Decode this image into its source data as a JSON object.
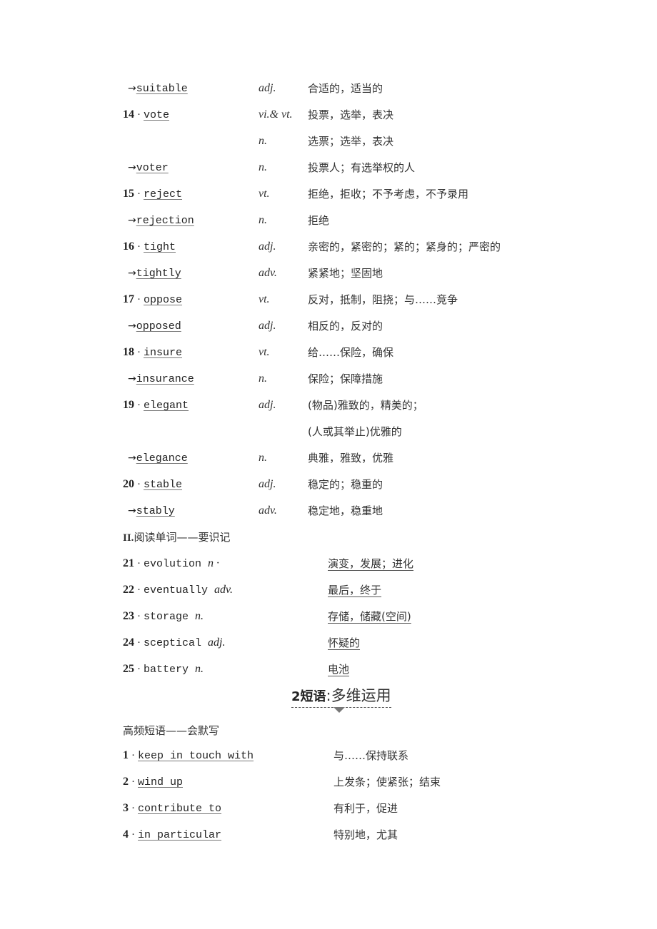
{
  "vocab": [
    {
      "num": "",
      "derived": true,
      "word": "suitable",
      "pos": "adj.",
      "meaning": "合适的，适当的"
    },
    {
      "num": "14",
      "derived": false,
      "word": "vote",
      "pos": "vi.& vt.",
      "meaning": "投票，选举，表决"
    },
    {
      "num": "",
      "derived": false,
      "word": "",
      "pos": "n.",
      "meaning": "选票；选举，表决"
    },
    {
      "num": "",
      "derived": true,
      "word": "voter",
      "pos": "n.",
      "meaning": "投票人；有选举权的人"
    },
    {
      "num": "15",
      "derived": false,
      "word": "reject",
      "pos": "vt.",
      "meaning": "拒绝，拒收；不予考虑，不予录用"
    },
    {
      "num": "",
      "derived": true,
      "word": "rejection",
      "pos": "n.",
      "meaning": "拒绝"
    },
    {
      "num": "16",
      "derived": false,
      "word": "tight",
      "pos": "adj.",
      "meaning": "亲密的，紧密的；紧的；紧身的；严密的"
    },
    {
      "num": "",
      "derived": true,
      "word": "tightly",
      "pos": "adv.",
      "meaning": "紧紧地；坚固地"
    },
    {
      "num": "17",
      "derived": false,
      "word": "oppose",
      "pos": "vt.",
      "meaning": "反对，抵制，阻挠；与……竞争"
    },
    {
      "num": "",
      "derived": true,
      "word": "opposed",
      "pos": "adj.",
      "meaning": "相反的，反对的"
    },
    {
      "num": "18",
      "derived": false,
      "word": "insure",
      "pos": "vt.",
      "meaning": "给……保险，确保"
    },
    {
      "num": "",
      "derived": true,
      "word": "insurance",
      "pos": "n.",
      "meaning": "保险；保障措施"
    },
    {
      "num": "19",
      "derived": false,
      "word": "elegant",
      "pos": "adj.",
      "meaning": "(物品)雅致的，精美的；"
    },
    {
      "num": "",
      "derived": false,
      "word": "",
      "pos": "",
      "meaning": "(人或其举止)优雅的"
    },
    {
      "num": "",
      "derived": true,
      "word": "elegance",
      "pos": "n.",
      "meaning": "典雅，雅致，优雅"
    },
    {
      "num": "20",
      "derived": false,
      "word": "stable",
      "pos": "adj.",
      "meaning": "稳定的；稳重的"
    },
    {
      "num": "",
      "derived": true,
      "word": "stably",
      "pos": "adv.",
      "meaning": "稳定地，稳重地"
    }
  ],
  "reading_section": {
    "title_num": "II.",
    "title": "阅读单词——要识记",
    "items": [
      {
        "num": "21",
        "word": "evolution",
        "pos": "n ·",
        "meaning": "演变，发展；进化"
      },
      {
        "num": "22",
        "word": "eventually",
        "pos": "adv.",
        "meaning": "最后，终于"
      },
      {
        "num": "23",
        "word": "storage",
        "pos": "n.",
        "meaning": "存储，储藏(空间)"
      },
      {
        "num": "24",
        "word": "sceptical",
        "pos": "adj.",
        "meaning": "怀疑的"
      },
      {
        "num": "25",
        "word": "battery",
        "pos": "n.",
        "meaning": "电池"
      }
    ]
  },
  "phrase_heading": {
    "num": "2",
    "bold": "短语",
    "sep": ":",
    "text": "多维运用"
  },
  "phrase_section": {
    "title": "高频短语——会默写",
    "items": [
      {
        "num": "1",
        "phrase": "keep in touch with",
        "meaning": "与……保持联系"
      },
      {
        "num": "2",
        "phrase": "wind up",
        "meaning": "上发条；使紧张；结束"
      },
      {
        "num": "3",
        "phrase": "contribute to",
        "meaning": "有利于，促进"
      },
      {
        "num": "4",
        "phrase": "in particular",
        "meaning": "特别地，尤其"
      }
    ]
  },
  "symbols": {
    "arrow": "→",
    "dot": "·"
  }
}
